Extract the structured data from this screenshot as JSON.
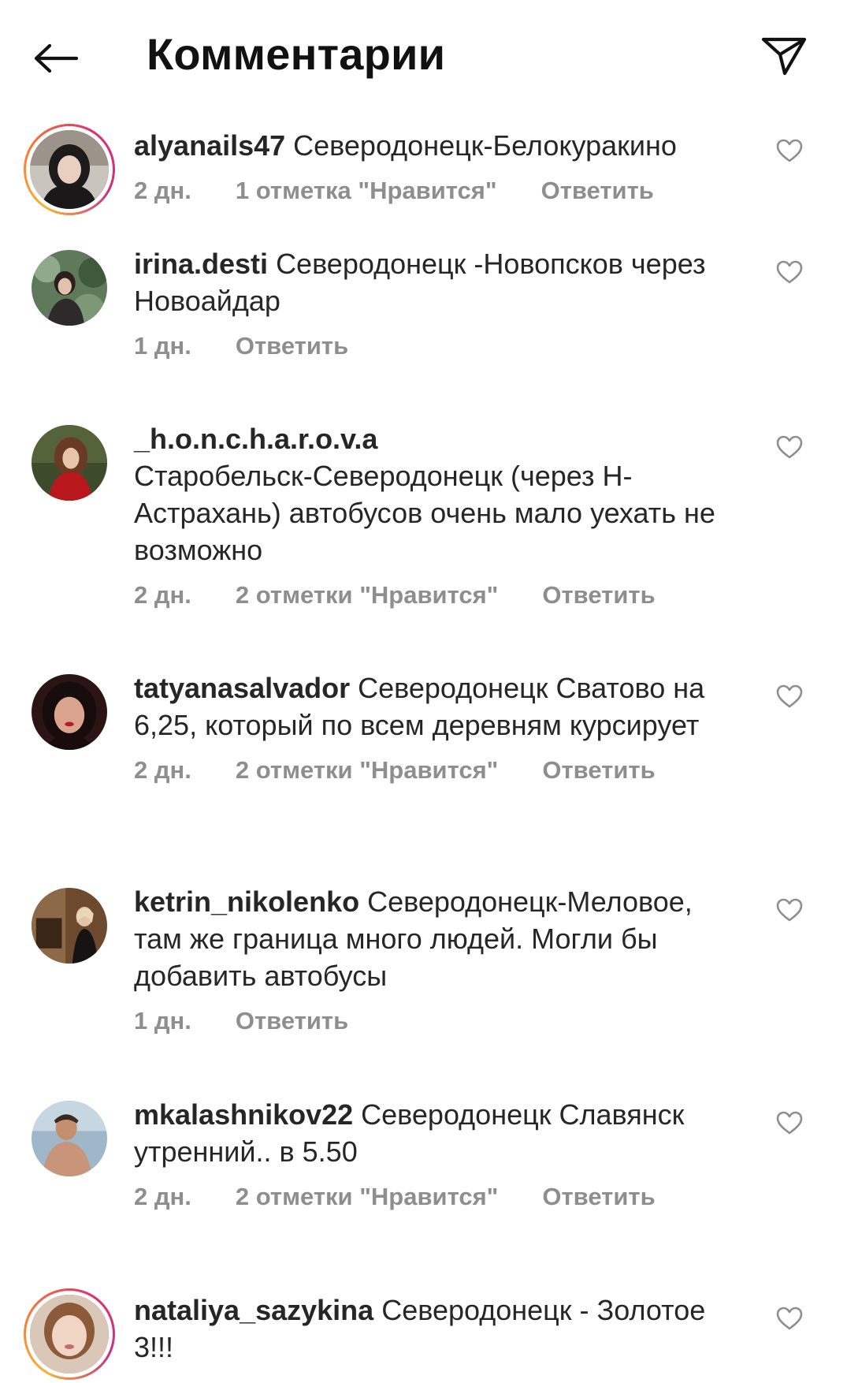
{
  "header": {
    "title": "Комментарии",
    "back_icon": "arrow-left-icon",
    "share_icon": "paper-plane-icon"
  },
  "comments": [
    {
      "username": "alyanails47",
      "text": "Северодонецк-Белокуракино",
      "time": "2 дн.",
      "likes": "1 отметка \"Нравится\"",
      "reply": "Ответить",
      "story_ring": true
    },
    {
      "username": "irina.desti",
      "text": "Северодонецк -Новопсков через Новоайдар",
      "time": "1 дн.",
      "likes": "",
      "reply": "Ответить",
      "story_ring": false
    },
    {
      "username": "_h.o.n.c.h.a.r.o.v.a",
      "text": "Старобельск-Северодонецк (через Н-Астрахань) автобусов очень мало уехать не возможно",
      "time": "2 дн.",
      "likes": "2 отметки \"Нравится\"",
      "reply": "Ответить",
      "story_ring": false
    },
    {
      "username": "tatyanasalvador",
      "text": "Северодонецк Сватово на 6,25, который по всем деревням курсирует",
      "time": "2 дн.",
      "likes": "2 отметки \"Нравится\"",
      "reply": "Ответить",
      "story_ring": false
    },
    {
      "username": "ketrin_nikolenko",
      "text": "Северодонецк-Меловое, там же граница много людей. Могли бы добавить автобусы",
      "time": "1 дн.",
      "likes": "",
      "reply": "Ответить",
      "story_ring": false
    },
    {
      "username": "mkalashnikov22",
      "text": "Северодонецк Славянск утренний.. в 5.50",
      "time": "2 дн.",
      "likes": "2 отметки \"Нравится\"",
      "reply": "Ответить",
      "story_ring": false
    },
    {
      "username": "nataliya_sazykina",
      "text": "Северодонецк - Золотое 3!!!",
      "time": "",
      "likes": "",
      "reply": "",
      "story_ring": true
    }
  ],
  "colors": {
    "text": "#262626",
    "meta": "#8e8e8e",
    "heart": "#8e8e8e"
  }
}
